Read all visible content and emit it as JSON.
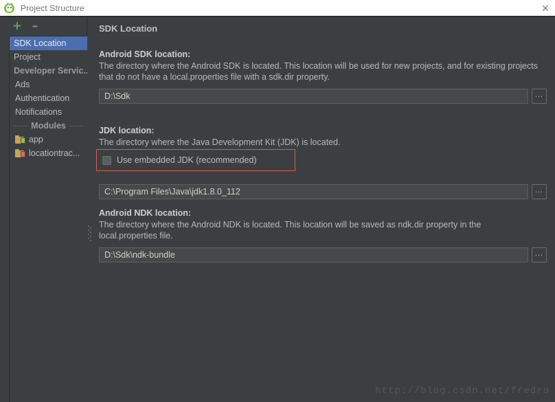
{
  "window": {
    "title": "Project Structure",
    "app_icon": "android-head-icon",
    "close_label": "✕"
  },
  "sidebar": {
    "toolbar": {
      "add_label": "+",
      "remove_label": "–"
    },
    "items": [
      {
        "label": "SDK Location",
        "type": "item",
        "selected": true
      },
      {
        "label": "Project",
        "type": "item",
        "selected": false
      },
      {
        "label": "Developer Servic...",
        "type": "group",
        "selected": false
      },
      {
        "label": "Ads",
        "type": "item",
        "selected": false
      },
      {
        "label": "Authentication",
        "type": "item",
        "selected": false
      },
      {
        "label": "Notifications",
        "type": "item",
        "selected": false
      }
    ],
    "modules_separator": "Modules",
    "modules": [
      {
        "label": "app",
        "icon": "module-app-icon"
      },
      {
        "label": "locationtrac...",
        "icon": "module-library-icon"
      }
    ]
  },
  "main": {
    "title": "SDK Location",
    "sections": [
      {
        "label": "Android SDK location:",
        "description": "The directory where the Android SDK is located. This location will be used for new projects, and for existing projects that do not have a local.properties file with a sdk.dir property.",
        "value": "D:\\Sdk",
        "browse_label": "..."
      },
      {
        "label": "JDK location:",
        "description": "The directory where the Java Development Kit (JDK) is located.",
        "checkbox_label": "Use embedded JDK (recommended)",
        "checkbox_checked": false,
        "value": "C:\\Program Files\\Java\\jdk1.8.0_112",
        "browse_label": "..."
      },
      {
        "label": "Android NDK location:",
        "description": "The directory where the Android NDK is located. This location will be saved as ndk.dir property in the local.properties file.",
        "value": "D:\\Sdk\\ndk-bundle",
        "browse_label": "..."
      }
    ]
  },
  "watermark": "http://blog.csdn.net/fredro",
  "colors": {
    "accent_selected": "#4b6eaf",
    "annotation_red": "#e05a53",
    "add_green": "#4caf50",
    "panel_bg": "#3c3f41",
    "field_bg": "#45494a"
  }
}
